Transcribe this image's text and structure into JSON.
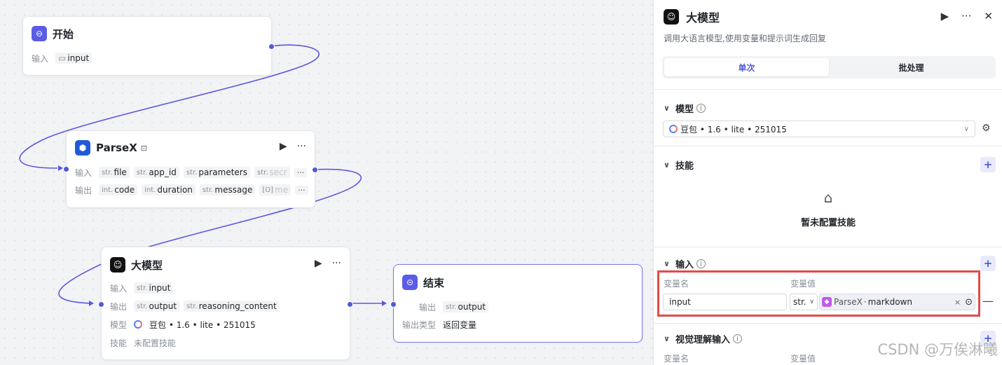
{
  "nodes": {
    "start": {
      "title": "开始",
      "input_label": "输入",
      "input_value": "input"
    },
    "parsex": {
      "title": "ParseX",
      "input_label": "输入",
      "inputs": [
        {
          "type": "str.",
          "name": "file"
        },
        {
          "type": "str.",
          "name": "app_id"
        },
        {
          "type": "str.",
          "name": "parameters"
        },
        {
          "type": "str.",
          "name": "secr"
        }
      ],
      "output_label": "输出",
      "outputs": [
        {
          "type": "int.",
          "name": "code"
        },
        {
          "type": "int.",
          "name": "duration"
        },
        {
          "type": "str.",
          "name": "message"
        },
        {
          "type": "[O]",
          "name": "me"
        }
      ],
      "more": "···"
    },
    "llm": {
      "title": "大模型",
      "input_label": "输入",
      "input": {
        "type": "str.",
        "name": "input"
      },
      "output_label": "输出",
      "outputs": [
        {
          "type": "str.",
          "name": "output"
        },
        {
          "type": "str.",
          "name": "reasoning_content"
        }
      ],
      "model_label": "模型",
      "model_value": "豆包 • 1.6 • lite • 251015",
      "skill_label": "技能",
      "skill_value": "未配置技能"
    },
    "end": {
      "title": "结束",
      "output_label": "输出",
      "output": {
        "type": "str.",
        "name": "output"
      },
      "output_type_label": "输出类型",
      "output_type_value": "返回变量"
    }
  },
  "panel": {
    "title": "大模型",
    "description": "调用大语言模型,使用变量和提示词生成回复",
    "tabs": [
      {
        "label": "单次",
        "active": true
      },
      {
        "label": "批处理",
        "active": false
      }
    ],
    "model_section": {
      "title": "模型",
      "selected": "豆包 • 1.6 • lite • 251015"
    },
    "skills_section": {
      "title": "技能",
      "empty_text": "暂未配置技能"
    },
    "input_section": {
      "title": "输入",
      "col_name": "变量名",
      "col_value": "变量值",
      "row": {
        "name": "input",
        "type": "str.",
        "source_node": "ParseX",
        "source_field": "markdown"
      }
    },
    "vision_section": {
      "title": "视觉理解输入",
      "col_name": "变量名",
      "col_value": "变量值"
    }
  },
  "watermark": "CSDN @万俟淋曦",
  "colors": {
    "accent": "#4e5bd6",
    "highlight": "#e24a4a"
  }
}
